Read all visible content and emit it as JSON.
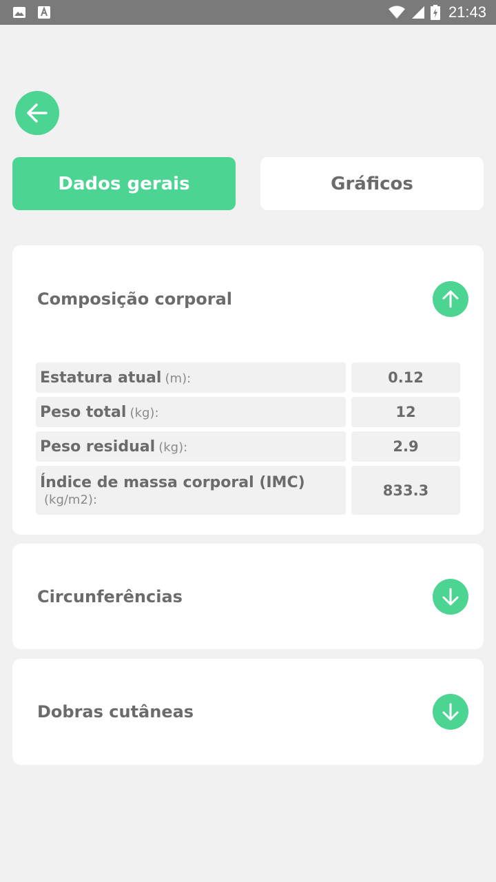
{
  "status_bar": {
    "time": "21:43",
    "icons": [
      "image-icon",
      "font-icon",
      "wifi-icon",
      "signal-icon",
      "battery-icon"
    ]
  },
  "nav": {
    "back_icon": "arrow-left-icon"
  },
  "tabs": [
    {
      "label": "Dados gerais",
      "active": true
    },
    {
      "label": "Gráficos",
      "active": false
    }
  ],
  "sections": {
    "composition": {
      "title": "Composição corporal",
      "expanded": true,
      "toggle_icon": "arrow-up-icon",
      "rows": [
        {
          "label": "Estatura atual",
          "unit": "(m):",
          "value": "0.12"
        },
        {
          "label": "Peso total",
          "unit": "(kg):",
          "value": "12"
        },
        {
          "label": "Peso residual",
          "unit": "(kg):",
          "value": "2.9"
        },
        {
          "label": "Índice de massa corporal (IMC)",
          "unit": "(kg/m2):",
          "value": "833.3"
        }
      ]
    },
    "circumferences": {
      "title": "Circunferências",
      "expanded": false,
      "toggle_icon": "arrow-down-icon"
    },
    "skinfolds": {
      "title": "Dobras cutâneas",
      "expanded": false,
      "toggle_icon": "arrow-down-icon"
    }
  },
  "colors": {
    "accent": "#4cd492",
    "background": "#f1f1f1",
    "text": "#6b6b6b",
    "status_bar": "#7a7a7a"
  }
}
